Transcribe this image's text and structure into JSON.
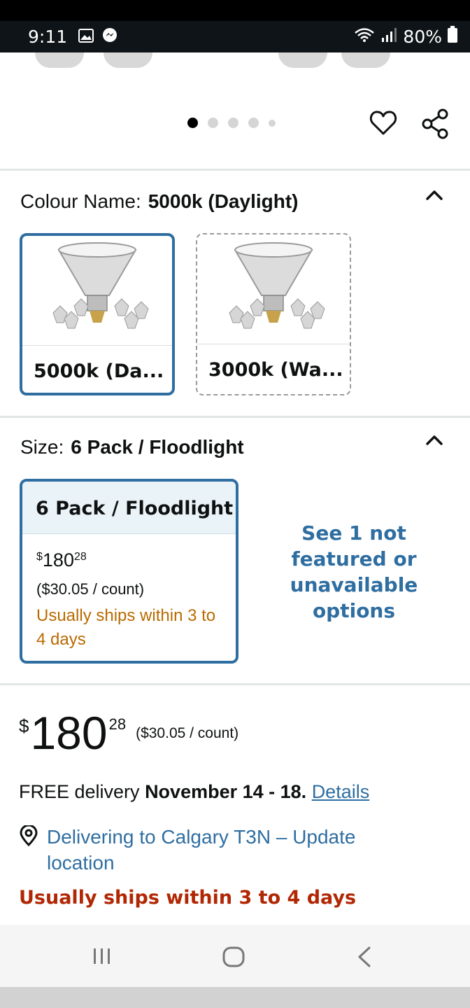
{
  "status_bar": {
    "time": "9:11",
    "battery": "80%"
  },
  "gallery": {
    "dots_total": 5,
    "active_dot": 0
  },
  "colour": {
    "label": "Colour Name:",
    "value": "5000k (Daylight)",
    "options": [
      {
        "label": "5000k (Da..."
      },
      {
        "label": "3000k (Wa..."
      }
    ]
  },
  "size": {
    "label": "Size:",
    "value": "6 Pack / Floodlight",
    "card": {
      "title": "6 Pack / Floodlight",
      "currency": "$",
      "price_whole": "180",
      "price_cents": "28",
      "unit_price": "($30.05 / count)",
      "ships": "Usually ships within 3 to 4 days"
    },
    "more_options": "See 1 not featured or unavailable options"
  },
  "buybox": {
    "currency": "$",
    "price_whole": "180",
    "price_cents": "28",
    "unit_price": "($30.05 / count)",
    "delivery_prefix": "FREE delivery ",
    "delivery_dates": "November 14 - 18.",
    "details_link": "Details",
    "location": "Delivering to Calgary T3N – Update location",
    "ships": "Usually ships within 3 to 4 days"
  },
  "colors": {
    "link": "#2f6ea1",
    "selected_border": "#2f6ea1",
    "ships_orange": "#b96b00",
    "ships_red": "#b12704"
  }
}
